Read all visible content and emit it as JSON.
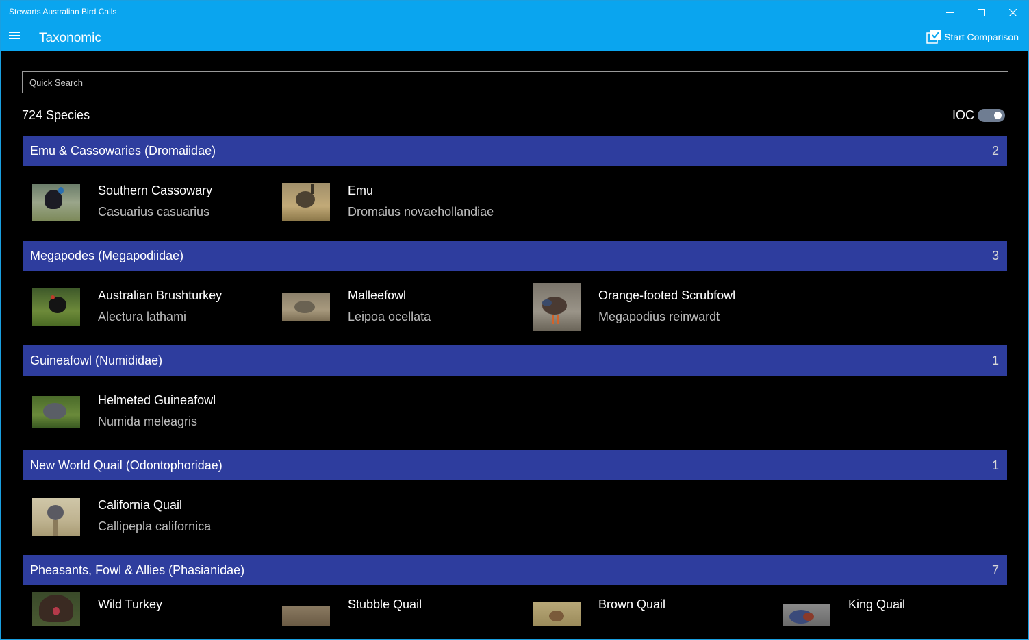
{
  "window": {
    "title": "Stewarts Australian Bird Calls"
  },
  "header": {
    "title": "Taxonomic",
    "start_comparison": "Start Comparison"
  },
  "search": {
    "placeholder": "Quick Search"
  },
  "species_count": "724 Species",
  "ioc": {
    "label": "IOC",
    "enabled": true
  },
  "colors": {
    "accent": "#0aa5ef",
    "group_header": "#2e3d9e",
    "background": "#000000"
  },
  "groups": [
    {
      "title": "Emu & Cassowaries (Dromaiidae)",
      "count": "2",
      "items": [
        {
          "name": "Southern Cassowary",
          "scientific": "Casuarius casuarius"
        },
        {
          "name": "Emu",
          "scientific": "Dromaius novaehollandiae"
        }
      ]
    },
    {
      "title": "Megapodes (Megapodiidae)",
      "count": "3",
      "items": [
        {
          "name": "Australian Brushturkey",
          "scientific": "Alectura lathami"
        },
        {
          "name": "Malleefowl",
          "scientific": "Leipoa ocellata"
        },
        {
          "name": "Orange-footed Scrubfowl",
          "scientific": "Megapodius reinwardt"
        }
      ]
    },
    {
      "title": "Guineafowl (Numididae)",
      "count": "1",
      "items": [
        {
          "name": "Helmeted Guineafowl",
          "scientific": "Numida meleagris"
        }
      ]
    },
    {
      "title": "New World Quail (Odontophoridae)",
      "count": "1",
      "items": [
        {
          "name": "California Quail",
          "scientific": "Callipepla californica"
        }
      ]
    },
    {
      "title": "Pheasants, Fowl & Allies (Phasianidae)",
      "count": "7",
      "items": [
        {
          "name": "Wild Turkey",
          "scientific": ""
        },
        {
          "name": "Stubble Quail",
          "scientific": ""
        },
        {
          "name": "Brown Quail",
          "scientific": ""
        },
        {
          "name": "King Quail",
          "scientific": ""
        }
      ]
    }
  ]
}
